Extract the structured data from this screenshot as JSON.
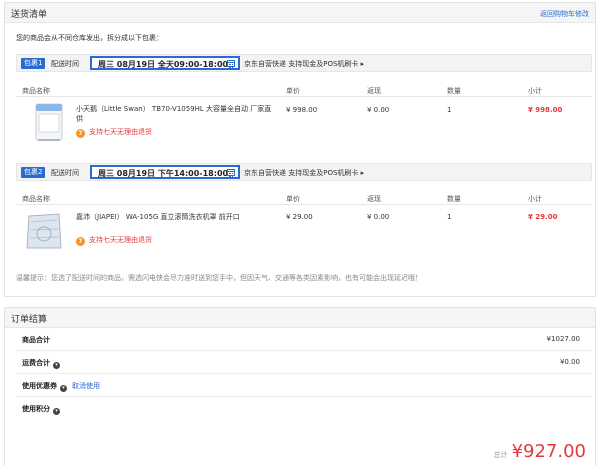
{
  "delivery": {
    "title": "送货清单",
    "back_link": "返回购物车修改",
    "notice": "您的商品会从不同仓库发出，拆分成以下包裹：",
    "packages": [
      {
        "tag": "包裹1",
        "time_label": "配送时间",
        "time": "周三 08月19日 全天09:00-18:00",
        "ship_info": "京东自营快递 支持现金及POS机刷卡 ▸",
        "headers": {
          "name": "商品名称",
          "price": "单价",
          "rebate": "返现",
          "qty": "数量",
          "subtotal": "小计"
        },
        "item": {
          "name": "小天鹅（Little Swan） TB70-V1059HL 大容量全自动 厂家直供",
          "support": "支持七天无理由退货",
          "price": "¥ 998.00",
          "rebate": "¥ 0.00",
          "qty": "1",
          "subtotal": "¥ 998.00"
        }
      },
      {
        "tag": "包裹2",
        "time_label": "配送时间",
        "time": "周三 08月19日 下午14:00-18:00",
        "ship_info": "京东自营快递 支持现金及POS机刷卡 ▸",
        "headers": {
          "name": "商品名称",
          "price": "单价",
          "rebate": "返现",
          "qty": "数量",
          "subtotal": "小计"
        },
        "item": {
          "name": "嘉沛（JIAPEI） WA-105G 直立滚筒洗衣机罩 前开口",
          "support": "支持七天无理由退货",
          "price": "¥ 29.00",
          "rebate": "¥ 0.00",
          "qty": "1",
          "subtotal": "¥ 29.00"
        }
      }
    ],
    "tip": "温馨提示：您选了配送时间的商品，需选闪电侠会尽力准时送到您手中，但因天气、交通等各类因素影响，也有可能会出现延迟哦！"
  },
  "summary": {
    "title": "订单结算",
    "rows": {
      "goods_total": {
        "label": "商品合计",
        "value": "¥1027.00"
      },
      "shipping": {
        "label": "运费合计",
        "value": "¥0.00"
      },
      "coupon": {
        "label": "使用优惠券",
        "link": "取消使用"
      },
      "points": {
        "label": "使用积分"
      }
    },
    "total_label": "总计",
    "total_amount": "¥927.00"
  },
  "colors": {
    "accent_blue": "#2a6bd1",
    "price_red": "#e4393c",
    "badge_orange": "#f7931e"
  },
  "icons": {
    "calendar": "calendar-icon",
    "support": "seven-day-return-icon",
    "expand": "chevron-down-icon"
  }
}
